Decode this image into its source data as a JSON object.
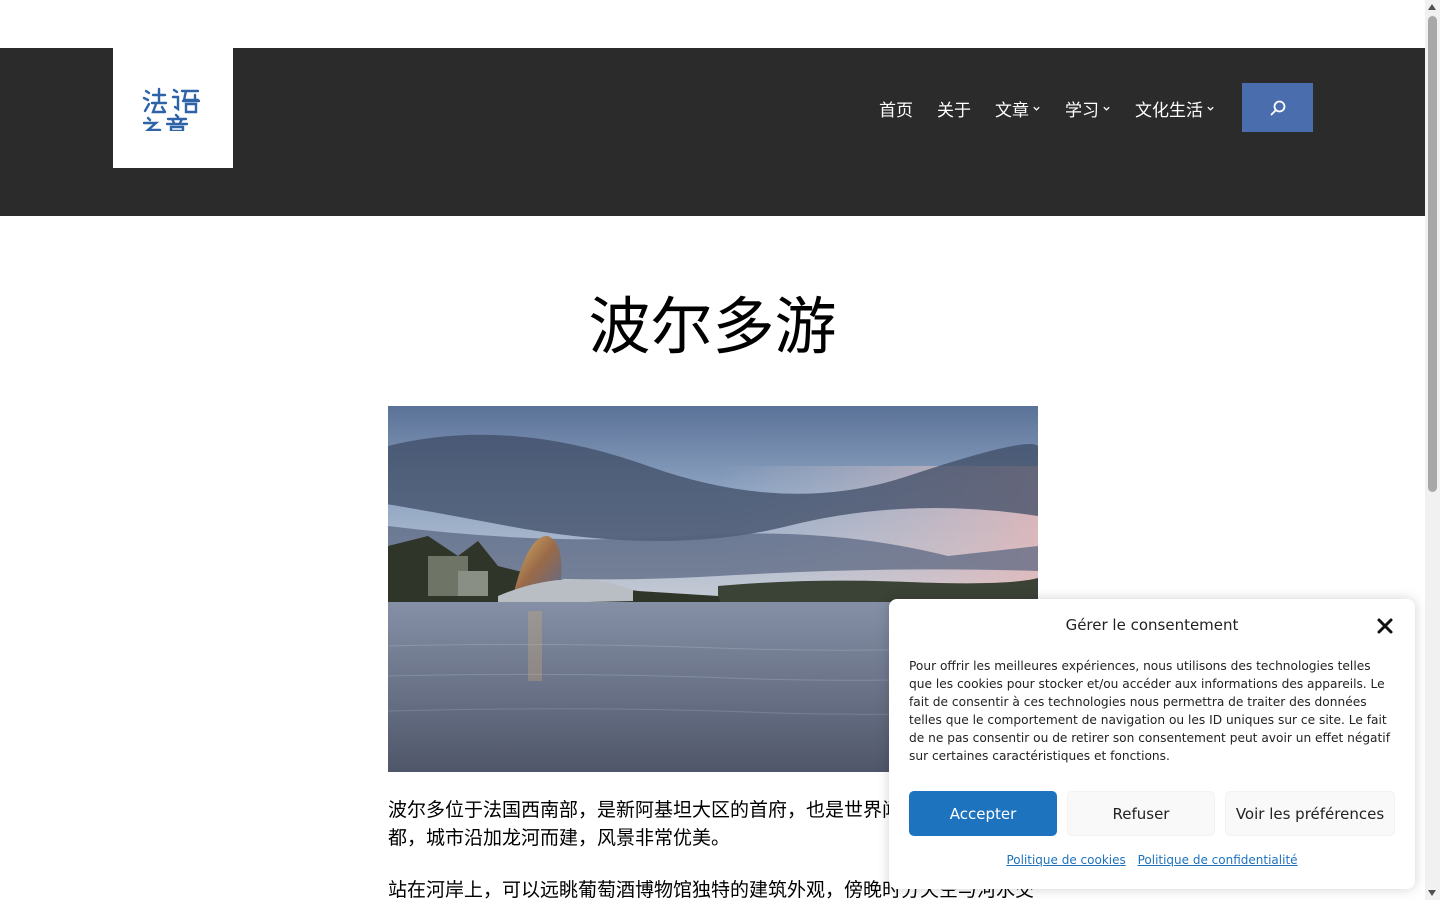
{
  "header": {
    "logo_text": "法语之音",
    "nav": [
      {
        "label": "首页",
        "has_dropdown": false
      },
      {
        "label": "关于",
        "has_dropdown": false
      },
      {
        "label": "文章",
        "has_dropdown": true
      },
      {
        "label": "学习",
        "has_dropdown": true
      },
      {
        "label": "文化生活",
        "has_dropdown": true
      }
    ],
    "search_icon": "search-icon",
    "colors": {
      "header_bg": "#2b2b2b",
      "search_bg": "#4a6dae"
    }
  },
  "main": {
    "title": "波尔多游",
    "hero_image": "river-city-wine-museum",
    "paragraphs": [
      "波尔多位于法国西南部，是新阿基坦大区的首府，也是世界闻名的葡萄酒之都，城市沿加龙河而建，风景非常优美。",
      "站在河岸上，可以远眺葡萄酒博物馆独特的建筑外观，傍晚时分天空与河水交相辉映。"
    ]
  },
  "consent": {
    "title": "Gérer le consentement",
    "body": "Pour offrir les meilleures expériences, nous utilisons des technologies telles que les cookies pour stocker et/ou accéder aux informations des appareils. Le fait de consentir à ces technologies nous permettra de traiter des données telles que le comportement de navigation ou les ID uniques sur ce site. Le fait de ne pas consentir ou de retirer son consentement peut avoir un effet négatif sur certaines caractéristiques et fonctions.",
    "accept_label": "Accepter",
    "refuse_label": "Refuser",
    "prefs_label": "Voir les préférences",
    "cookie_policy_label": "Politique de cookies",
    "privacy_policy_label": "Politique de confidentialité",
    "accent": "#1e73be"
  }
}
